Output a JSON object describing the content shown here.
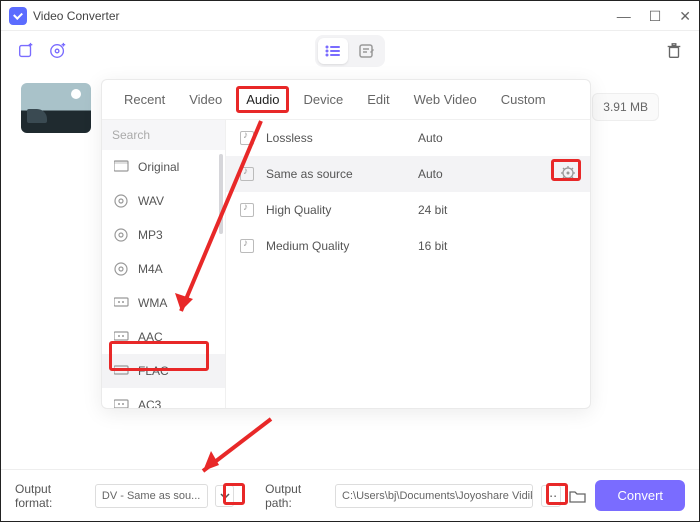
{
  "window": {
    "title": "Video Converter"
  },
  "file": {
    "size": "3.91 MB"
  },
  "tabs": [
    "Recent",
    "Video",
    "Audio",
    "Device",
    "Edit",
    "Web Video",
    "Custom"
  ],
  "activeTab": "Audio",
  "search": {
    "placeholder": "Search"
  },
  "sidebar": {
    "items": [
      {
        "label": "Original"
      },
      {
        "label": "WAV"
      },
      {
        "label": "MP3"
      },
      {
        "label": "M4A"
      },
      {
        "label": "WMA"
      },
      {
        "label": "AAC"
      },
      {
        "label": "FLAC"
      },
      {
        "label": "AC3"
      }
    ],
    "selected": "FLAC"
  },
  "quality": {
    "items": [
      {
        "name": "Lossless",
        "value": "Auto"
      },
      {
        "name": "Same as source",
        "value": "Auto"
      },
      {
        "name": "High Quality",
        "value": "24 bit"
      },
      {
        "name": "Medium Quality",
        "value": "16 bit"
      }
    ]
  },
  "output": {
    "format_label": "Output format:",
    "format_value": "DV - Same as sou...",
    "path_label": "Output path:",
    "path_value": "C:\\Users\\bj\\Documents\\Joyoshare Vidik"
  },
  "convert_label": "Convert"
}
